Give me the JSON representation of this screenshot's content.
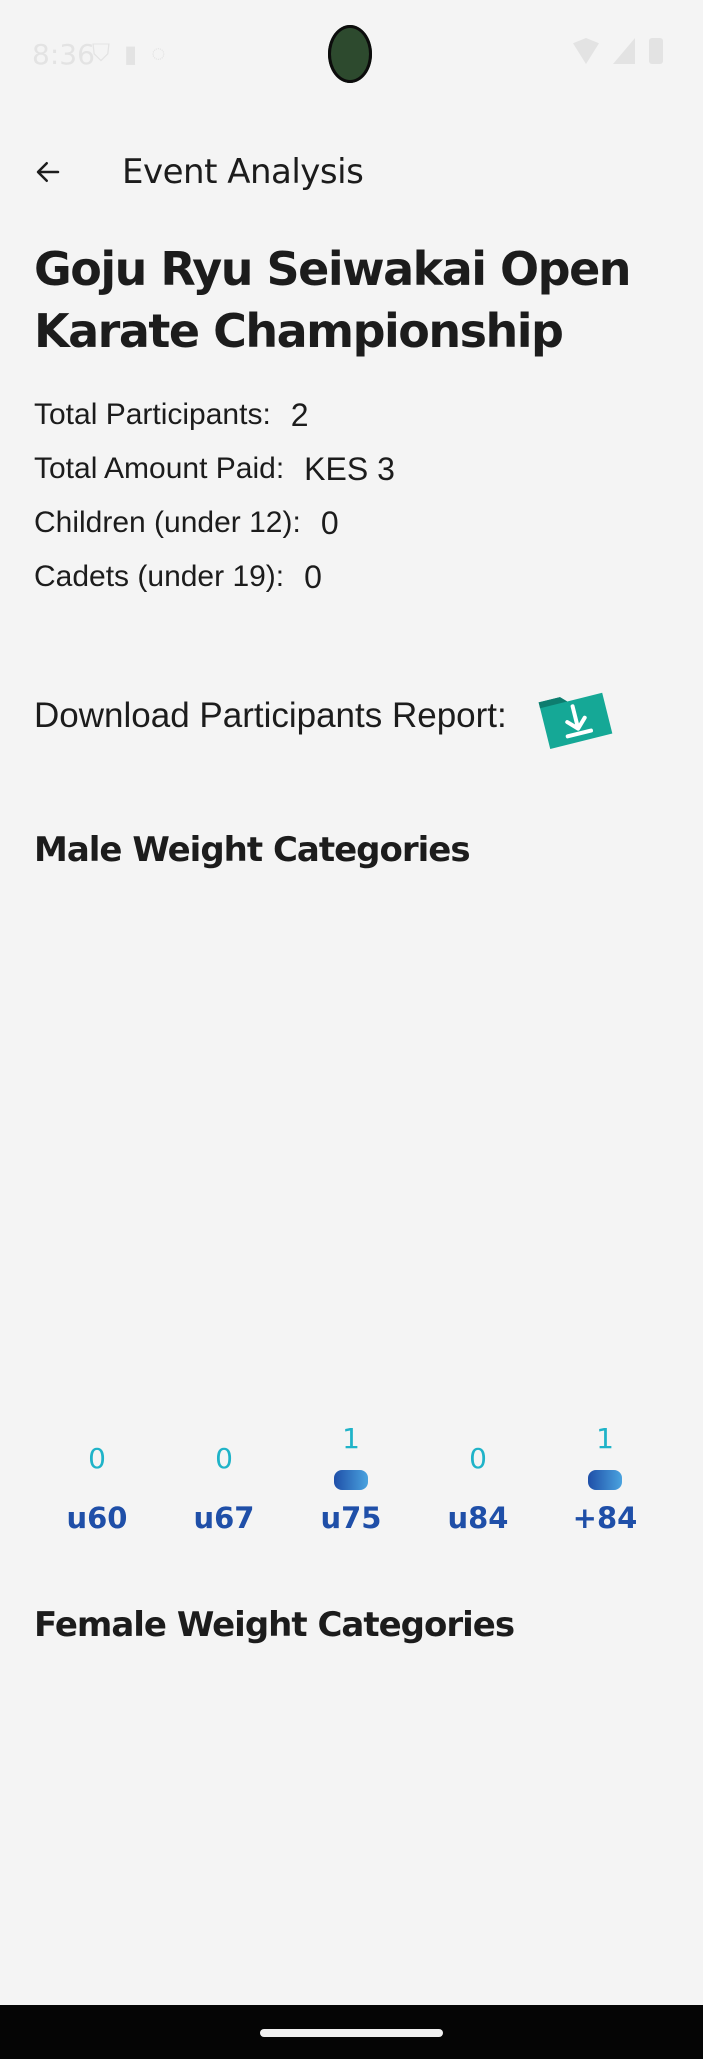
{
  "status_bar": {
    "time": "8:36",
    "icons": [
      "shield-icon",
      "sd-card-icon",
      "circle-icon",
      "wifi-icon",
      "signal-icon",
      "battery-icon"
    ]
  },
  "app_bar": {
    "title": "Event Analysis",
    "back_icon": "arrow-back-icon"
  },
  "event": {
    "title": "Goju Ryu Seiwakai Open Karate Championship",
    "stats": [
      {
        "label": "Total Participants:",
        "value": "2"
      },
      {
        "label": "Total Amount Paid:",
        "value": "KES 3"
      },
      {
        "label": "Children (under 12):",
        "value": "0"
      },
      {
        "label": "Cadets (under 19):",
        "value": "0"
      }
    ]
  },
  "download": {
    "label": "Download Participants Report:",
    "icon": "folder-download-icon",
    "icon_color": "#15a896"
  },
  "sections": {
    "male": "Male Weight Categories",
    "female": "Female Weight Categories"
  },
  "chart_data": {
    "type": "bar",
    "categories": [
      "u60",
      "u67",
      "u75",
      "u84",
      "+84"
    ],
    "values": [
      0,
      0,
      1,
      0,
      1
    ],
    "title": "Male Weight Categories",
    "ylim": [
      0,
      1
    ],
    "grid": false,
    "value_label_color": "#1fb3c8",
    "category_label_color": "#1f4fa8",
    "bar_gradient": [
      "#1f4fa8",
      "#4aa3df"
    ]
  },
  "colors": {
    "background": "#f4f4f4",
    "text": "#1c1c1c",
    "nav_bar": "#050505"
  }
}
